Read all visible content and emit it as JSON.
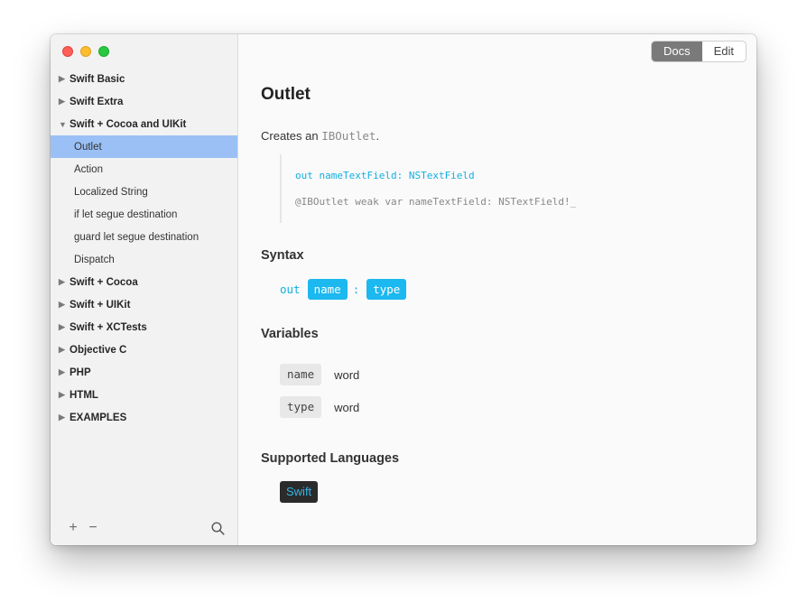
{
  "window": {
    "traffic_lights": {
      "close": "#fe5f57",
      "minimize": "#febc2e",
      "maximize": "#28c840"
    }
  },
  "sidebar": {
    "items": [
      {
        "type": "group",
        "label": "Swift Basic",
        "expanded": false
      },
      {
        "type": "group",
        "label": "Swift Extra",
        "expanded": false
      },
      {
        "type": "group",
        "label": "Swift + Cocoa and UIKit",
        "expanded": true
      },
      {
        "type": "child",
        "label": "Outlet",
        "selected": true
      },
      {
        "type": "child",
        "label": "Action"
      },
      {
        "type": "child",
        "label": "Localized String"
      },
      {
        "type": "child",
        "label": "if let segue destination"
      },
      {
        "type": "child",
        "label": "guard let segue destination"
      },
      {
        "type": "child",
        "label": "Dispatch"
      },
      {
        "type": "group",
        "label": "Swift + Cocoa",
        "expanded": false
      },
      {
        "type": "group",
        "label": "Swift + UIKit",
        "expanded": false
      },
      {
        "type": "group",
        "label": "Swift + XCTests",
        "expanded": false
      },
      {
        "type": "group",
        "label": "Objective C",
        "expanded": false
      },
      {
        "type": "group",
        "label": "PHP",
        "expanded": false
      },
      {
        "type": "group",
        "label": "HTML",
        "expanded": false
      },
      {
        "type": "group",
        "label": "EXAMPLES",
        "expanded": false
      }
    ],
    "footer": {
      "add": "+",
      "remove": "−",
      "search_icon": "search-icon"
    },
    "arrows": {
      "collapsed": "▶",
      "expanded": "▼"
    },
    "selected_color": "#9ac0f5"
  },
  "toolbar": {
    "segments": [
      {
        "label": "Docs",
        "active": true
      },
      {
        "label": "Edit",
        "active": false
      }
    ]
  },
  "doc": {
    "title": "Outlet",
    "description_prefix": "Creates an",
    "description_code": "IBOutlet",
    "description_suffix": ".",
    "example": {
      "trigger": "out nameTextField: NSTextField",
      "expansion": "@IBOutlet weak var nameTextField: NSTextField!_"
    },
    "syntax_heading": "Syntax",
    "syntax": {
      "keyword": "out",
      "placeholder1": "name",
      "separator": ":",
      "placeholder2": "type"
    },
    "variables_heading": "Variables",
    "variables": [
      {
        "name": "name",
        "type": "word"
      },
      {
        "name": "type",
        "type": "word"
      }
    ],
    "languages_heading": "Supported Languages",
    "languages": [
      "Swift"
    ],
    "accent_color": "#1cb8f0"
  }
}
